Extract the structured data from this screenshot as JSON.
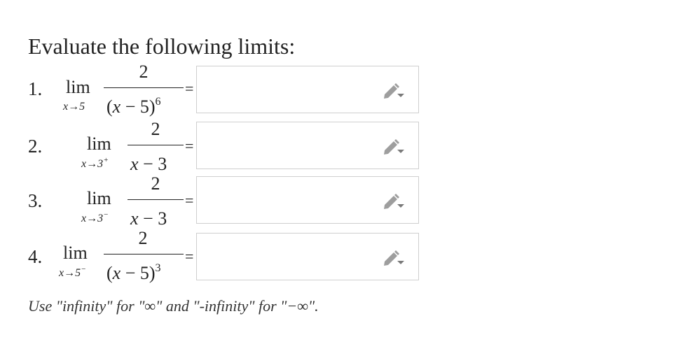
{
  "title": "Evaluate the following limits:",
  "problems": [
    {
      "number": "1.",
      "lim": "lim",
      "sub_var": "x→5",
      "sub_sup": "",
      "numerator": "2",
      "den_open": "(",
      "den_var": "x",
      "den_rest": " − 5)",
      "den_exp": "6",
      "eq": "=",
      "answer": ""
    },
    {
      "number": "2.",
      "lim": "lim",
      "sub_var": "x→3",
      "sub_sup": "+",
      "numerator": "2",
      "den_open": "",
      "den_var": "x",
      "den_rest": " − 3",
      "den_exp": "",
      "eq": "=",
      "answer": ""
    },
    {
      "number": "3.",
      "lim": "lim",
      "sub_var": "x→3",
      "sub_sup": "−",
      "numerator": "2",
      "den_open": "",
      "den_var": "x",
      "den_rest": " − 3",
      "den_exp": "",
      "eq": "=",
      "answer": ""
    },
    {
      "number": "4.",
      "lim": "lim",
      "sub_var": "x→5",
      "sub_sup": "−",
      "numerator": "2",
      "den_open": "(",
      "den_var": "x",
      "den_rest": " − 5)",
      "den_exp": "3",
      "eq": "=",
      "answer": ""
    }
  ],
  "icon": "pencil-icon",
  "note": "Use \"infinity\" for \"∞\" and \"-infinity\" for \"−∞\"."
}
